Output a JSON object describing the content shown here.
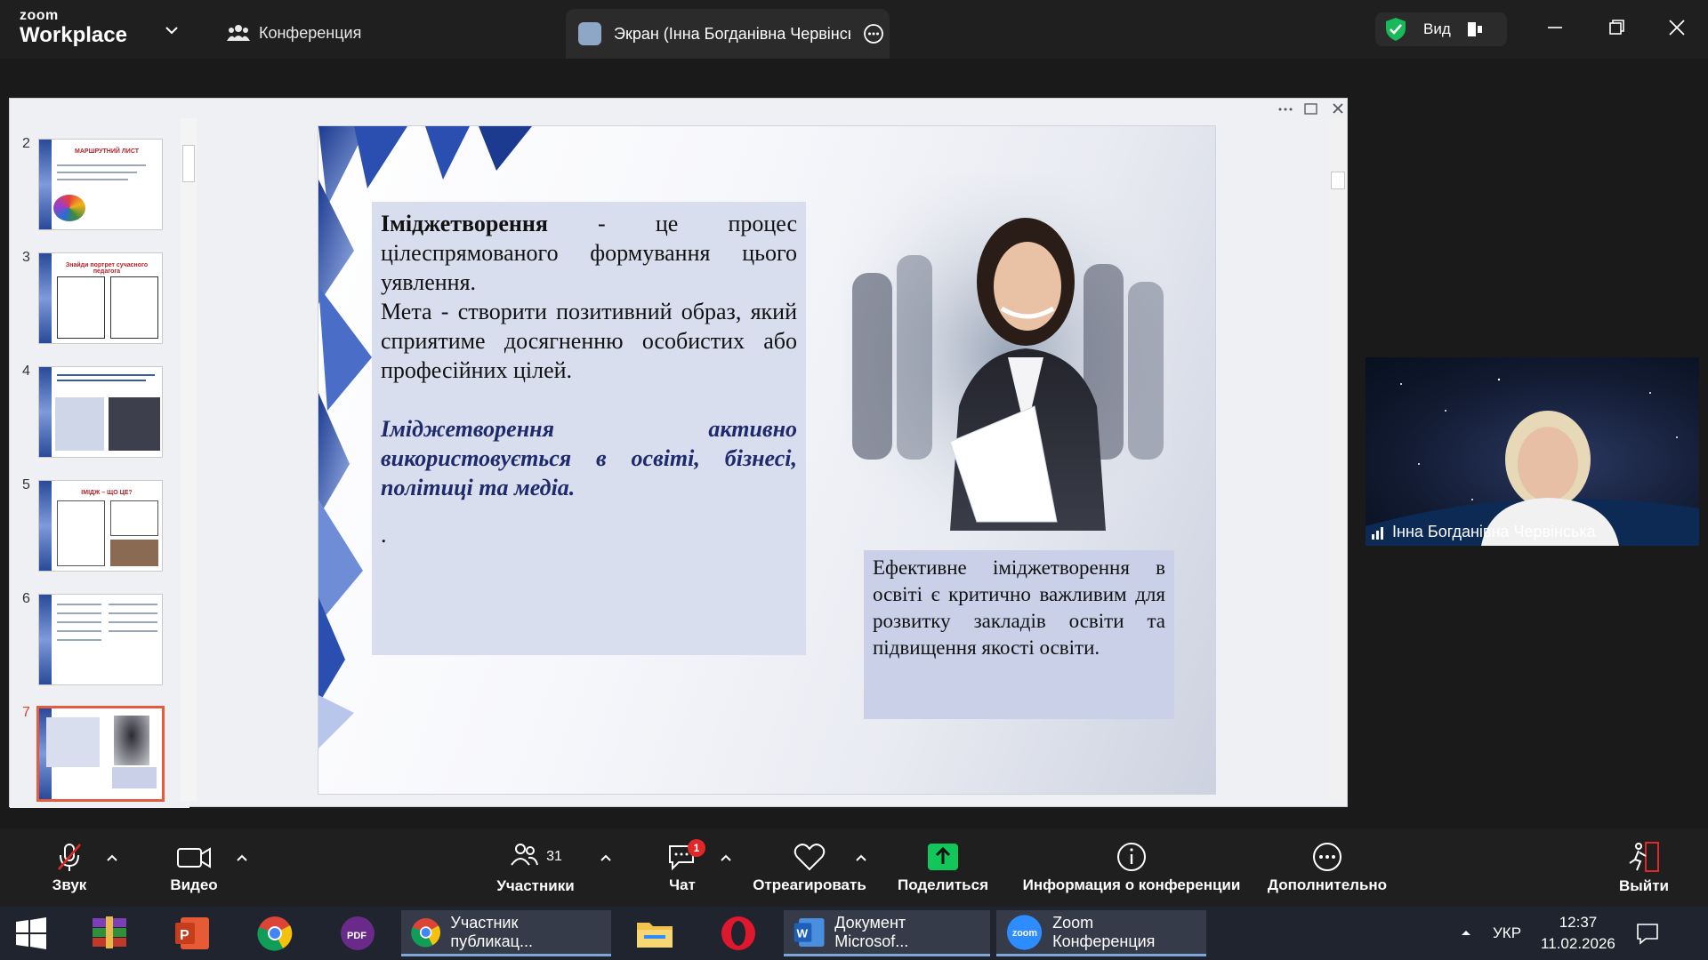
{
  "app": {
    "logo_small": "zoom",
    "logo_large": "Workplace"
  },
  "tabs": {
    "conference": "Конференция",
    "screen": "Экран (Інна Богданівна Червінська)"
  },
  "view_button": "Вид",
  "slides": {
    "thumbnails": [
      {
        "num": "2",
        "title": "МАРШРУТНИЙ ЛИСТ"
      },
      {
        "num": "3",
        "title": "Знайди портрет сучасного педагога"
      },
      {
        "num": "4",
        "title": ""
      },
      {
        "num": "5",
        "title": "ІМІДЖ – ЩО ЦЕ?"
      },
      {
        "num": "6",
        "title": ""
      },
      {
        "num": "7",
        "title": ""
      }
    ],
    "current": {
      "p1_bold": "Іміджетворення",
      "p1_rest": " - це процес цілеспрямованого формування цього уявлення.",
      "p2": "Мета - створити позитивний образ, який сприятиме досягненню особистих або професійних цілей.",
      "p3": "Іміджетворення активно використовується в освіті, бізнесі, політиці та медіа.",
      "p4": ".",
      "box2": "Ефективне іміджетворення в освіті є критично важливим для розвитку закладів освіти та підвищення якості освіти."
    }
  },
  "video": {
    "participant_name": "Інна Богданівна Червінська"
  },
  "toolbar": {
    "audio": "Звук",
    "video": "Видео",
    "participants": "Участники",
    "participants_count": "31",
    "chat": "Чат",
    "chat_badge": "1",
    "react": "Отреагировать",
    "share": "Поделиться",
    "info": "Информация о конференции",
    "more": "Дополнительно",
    "leave": "Выйти"
  },
  "taskbar": {
    "chrome_window": "Участник публикац...",
    "word_window": "Документ Microsof...",
    "zoom_window": "Zoom Конференция",
    "language": "УКР",
    "time": "12:37",
    "date": "11.02.2026"
  },
  "colors": {
    "accent_blue": "#2d8cff",
    "share_green": "#12c75a",
    "leave_red": "#e02828"
  }
}
